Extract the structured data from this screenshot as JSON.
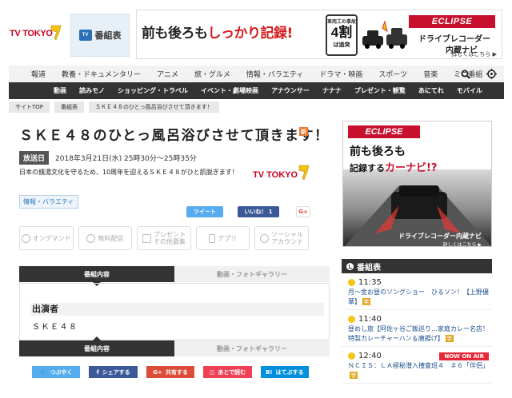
{
  "header": {
    "logo_text": "TV TOKYO",
    "program_guide_label": "番組表",
    "program_guide_icon_text": "TV"
  },
  "top_ad": {
    "main_text_a": "前も後ろも",
    "main_text_b": "しっかり記録!",
    "badge_small": "車両工の事故",
    "badge_number": "4割",
    "badge_bottom": "は追突",
    "brand": "ECLIPSE",
    "sub1": "ドライブレコーダー",
    "sub2": "内蔵ナビ",
    "more": "詳しくはこちら ▶"
  },
  "nav_primary": [
    "報道",
    "教養・ドキュメンタリー",
    "アニメ",
    "旅・グルメ",
    "情報・バラエティ",
    "ドラマ・映画",
    "スポーツ",
    "音楽",
    "ミニ番組"
  ],
  "nav_secondary": [
    "動画",
    "読みモノ",
    "ショッピング・トラベル",
    "イベント・劇場映画",
    "アナウンサー",
    "ナナナ",
    "プレゼント・観覧",
    "あにてれ",
    "モバイル"
  ],
  "breadcrumb": [
    "サイトTOP",
    "番組表",
    "ＳＫＥ４８のひとっ風呂浴びさせて頂きます！"
  ],
  "program": {
    "title": "ＳＫＥ４８のひとっ風呂浴びさせて頂きます！",
    "new_badge": "新",
    "broadcast_label": "放送日",
    "broadcast_date": "2018年3月21日(水) 25時30分～25時35分",
    "description": "日本の銭湯文化を守るため、10周年を迎えるＳＫＥ４８がひと肌脱ぎます！",
    "genre": "情報・バラエティ",
    "tweet_label": "ツイート",
    "like_label": "いいね！ 1",
    "gplus_label": "G+"
  },
  "actions": [
    "オンデマンド",
    "無料配信",
    "プレゼント\nその他募集",
    "アプリ",
    "ソーシャル\nアカウント"
  ],
  "tabs": {
    "content": "番組内容",
    "gallery": "動画・フォトギャラリー"
  },
  "cast": {
    "heading": "出演者",
    "value": "ＳＫＥ４８"
  },
  "share": {
    "twitter": "つぶやく",
    "facebook": "シェアする",
    "gplus": "共有する",
    "pocket": "あとで読む",
    "hatena": "はてぶする"
  },
  "side_ad": {
    "brand": "ECLIPSE",
    "headline1": "前も後ろも",
    "headline2a": "記録する",
    "headline2b": "カーナビ!?",
    "footer1": "ドライブレコーダー内蔵ナビ",
    "footer2": "詳しくはこちら ▶"
  },
  "schedule": {
    "heading": "番組表",
    "on_air_label": "NOW ON AIR",
    "items": [
      {
        "time": "11:35",
        "title": "月～金お昼のソングショー　ひるソン！【上野優華】",
        "badge": "字"
      },
      {
        "time": "11:40",
        "title": "昼めし旅【阿佐ヶ谷ご飯巡り…家庭カレー名店！特製カレーチャーハン＆唐揚げ】",
        "badge": "字"
      },
      {
        "time": "12:40",
        "title": "ＮＣＩＳ：ＬＡ極秘潜入捜査班４　＃６「伴侶」",
        "badge": "字"
      }
    ]
  },
  "colors": {
    "brand_red": "#c8102e",
    "nav_dark": "#333333",
    "twitter": "#55acee",
    "facebook": "#3b5998",
    "gplus": "#dd4b39",
    "pocket": "#ef4056",
    "hatena": "#008fde",
    "on_air": "#e8273a"
  }
}
